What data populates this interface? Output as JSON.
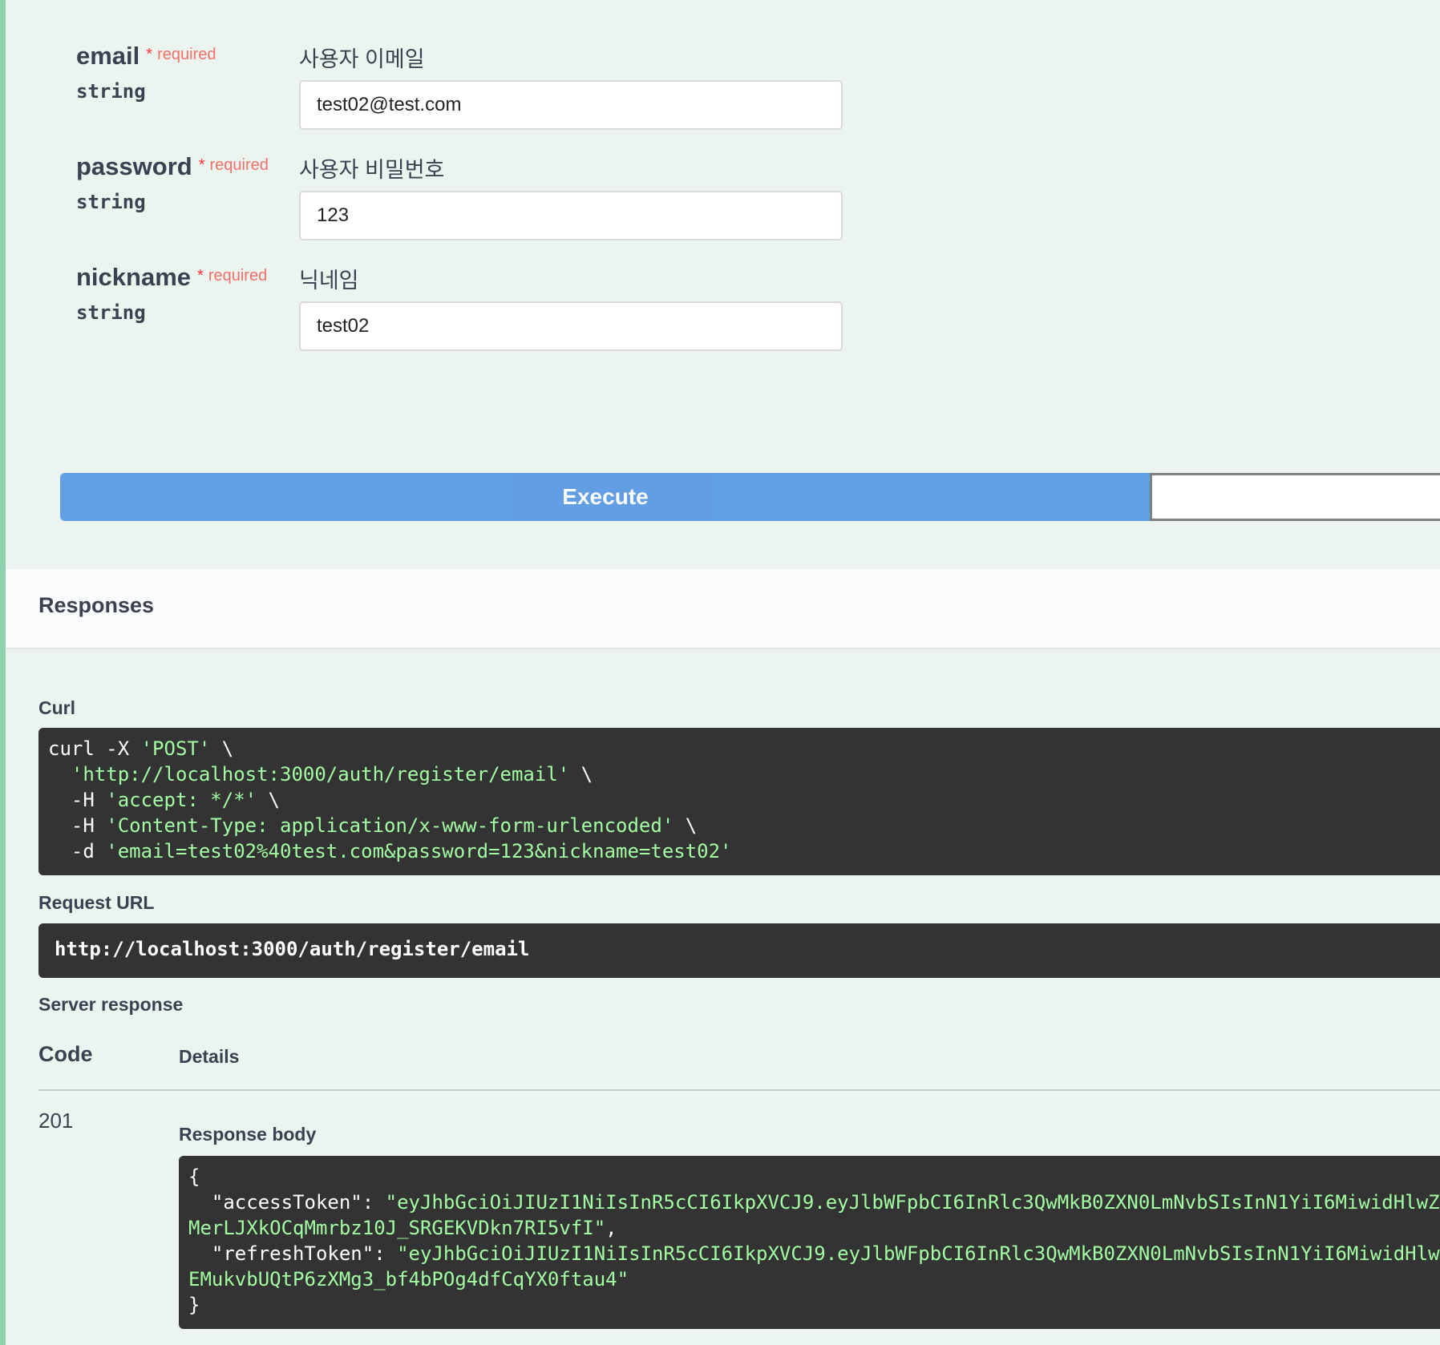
{
  "params": [
    {
      "name": "email",
      "star": "*",
      "required": "required",
      "type": "string",
      "description": "사용자 이메일",
      "value": "test02@test.com"
    },
    {
      "name": "password",
      "star": "*",
      "required": "required",
      "type": "string",
      "description": "사용자 비밀번호",
      "value": "123"
    },
    {
      "name": "nickname",
      "star": "*",
      "required": "required",
      "type": "string",
      "description": "닉네임",
      "value": "test02"
    }
  ],
  "execute_label": "Execute",
  "responses_title": "Responses",
  "curl_label": "Curl",
  "curl": {
    "l1a": "curl -X ",
    "l1b": "'POST'",
    "l1c": " \\",
    "l2a": "  ",
    "l2b": "'http://localhost:3000/auth/register/email'",
    "l2c": " \\",
    "l3a": "  -H ",
    "l3b": "'accept: */*'",
    "l3c": " \\",
    "l4a": "  -H ",
    "l4b": "'Content-Type: application/x-www-form-urlencoded'",
    "l4c": " \\",
    "l5a": "  -d ",
    "l5b": "'email=test02%40test.com&password=123&nickname=test02'"
  },
  "request_url_label": "Request URL",
  "request_url": "http://localhost:3000/auth/register/email",
  "server_response_label": "Server response",
  "table": {
    "code_header": "Code",
    "details_header": "Details"
  },
  "response": {
    "code": "201",
    "body_label": "Response body",
    "open_brace": "{",
    "access_key": "  \"accessToken\": ",
    "access_val_1": "\"eyJhbGciOiJIUzI1NiIsInR5cCI6IkpXVCJ9.eyJlbWFpbCI6InRlc3QwMkB0ZXN0LmNvbSIsInN1YiI6MiwidHlwZS",
    "access_val_2": "MerLJXkOCqMmrbz10J_SRGEKVDkn7RI5vfI\"",
    "comma": ",",
    "refresh_key": "  \"refreshToken\": ",
    "refresh_val_1": "\"eyJhbGciOiJIUzI1NiIsInR5cCI6IkpXVCJ9.eyJlbWFpbCI6InRlc3QwMkB0ZXN0LmNvbSIsInN1YiI6MiwidHlwZ",
    "refresh_val_2": "EMukvbUQtP6zXMg3_bf4bPOg4dfCqYX0ftau4\"",
    "close_brace": "}"
  }
}
